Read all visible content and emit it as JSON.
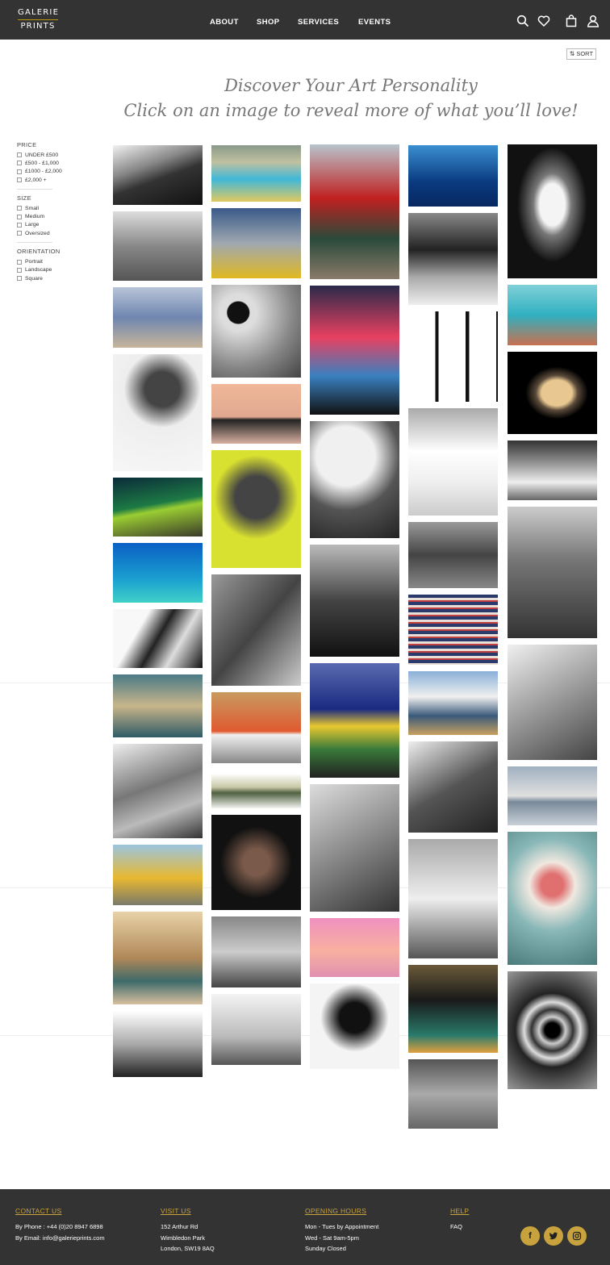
{
  "header": {
    "logo_top": "GALERIE",
    "logo_bottom": "PRINTS",
    "nav": [
      "ABOUT",
      "SHOP",
      "SERVICES",
      "EVENTS"
    ]
  },
  "sort_label": "⇅ SORT",
  "hero": {
    "line1": "Discover Your Art Personality",
    "line2": "Click on an image to reveal more of what you’ll love!"
  },
  "filters": {
    "price": {
      "title": "PRICE",
      "options": [
        "UNDER £500",
        "£500 - £1,000",
        "£1000 - £2,000",
        "£2,000 +"
      ]
    },
    "size": {
      "title": "SIZE",
      "options": [
        "Small",
        "Medium",
        "Large",
        "Oversized"
      ]
    },
    "orientation": {
      "title": "ORIENTATION",
      "options": [
        "Portrait",
        "Landscape",
        "Square"
      ]
    }
  },
  "gallery": {
    "columns": [
      [
        "ocean-waves-aerial",
        "elephant-tram",
        "stepwell-red-saris",
        "audrey-hepburn-portrait",
        "aurora-borealis",
        "turquoise-sea",
        "abstract-architecture",
        "men-car-street",
        "woman-balcony",
        "yellow-car-women",
        "woman-armchair-room",
        "giant-shoe-sculpture"
      ],
      [
        "pool-party",
        "twin-women-street",
        "polka-dot-hats",
        "rowing-sunset",
        "twiggy-yellow",
        "couple-film-still",
        "zebra-orange-chairs",
        "wetland-landscape",
        "queen-band-portrait",
        "vintage-car-women",
        "bulldog-puppy"
      ],
      [
        "parachute-woman",
        "neon-paris-night",
        "clock-hat-woman",
        "eiffel-tower-gate",
        "batman-robin",
        "shadow-dancers",
        "pink-lifeguard-tower",
        "veiled-hat-woman"
      ],
      [
        "dolphin-underwater",
        "louis-armstrong-spaghetti",
        "bowie-contact-sheet",
        "man-snow-tuxedo",
        "legs-paris-street",
        "cut-books-stripes",
        "snow-mountain-picnic",
        "salvador-dali",
        "roller-skater",
        "casino-table-party",
        "leopard-walker"
      ],
      [
        "taj-mahal-arch",
        "pool-backgammon",
        "saturn-planet",
        "boxing-ring",
        "new-york-aerial",
        "man-payphone",
        "zebras-horizon",
        "rajasthani-man-door",
        "spiral-staircase"
      ]
    ]
  },
  "footer": {
    "contact": {
      "title": "CONTACT US",
      "phone_label": "By Phone :",
      "phone": "+44 (0)20 8947 6898",
      "email_label": "By Email:",
      "email": "info@galerieprints.com"
    },
    "visit": {
      "title": "VISIT US",
      "lines": [
        "152 Arthur Rd",
        "Wimbledon Park",
        "London, SW19 8AQ"
      ]
    },
    "hours": {
      "title": "OPENING HOURS",
      "lines": [
        "Mon - Tues by Appointment",
        "Wed - Sat 9am-5pm",
        "Sunday Closed"
      ]
    },
    "help": {
      "title": "HELP",
      "link": "FAQ"
    },
    "social": {
      "facebook": "f"
    }
  },
  "colors": {
    "header_bg": "#333333",
    "accent": "#c8a23c"
  }
}
